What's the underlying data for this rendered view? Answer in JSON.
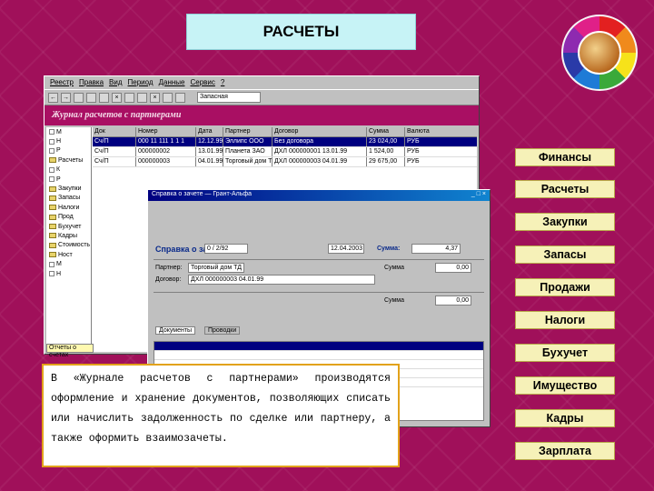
{
  "slide": {
    "title": "РАСЧЕТЫ"
  },
  "app_window": {
    "menu": [
      "Реестр",
      "Правка",
      "Вид",
      "Период",
      "Данные",
      "Сервис",
      "?"
    ],
    "toolbar_combo": "Запасная",
    "journal_title": "Журнал расчетов с партнерами",
    "tree_items": [
      "М",
      "Н",
      "Р",
      "Расчеты",
      "К",
      "Р",
      "Закупки",
      "Запасы",
      "Налоги",
      "Прод",
      "Бухучет",
      "Кадры",
      "Стоимость",
      "Ност",
      "М",
      "Н"
    ],
    "tree_footer": "Отчеты о счетах",
    "columns": [
      "Док",
      "Номер",
      "Дата",
      "Партнер",
      "Договор",
      "Сумма",
      "Валюта"
    ],
    "rows": [
      [
        "Сч/П",
        "000 11 111 1 1 1",
        "12.12.99",
        "Эллипс ООО",
        "Без договора",
        "23 024,00",
        "РУБ"
      ],
      [
        "Сч/П",
        "000000002",
        "13.01.99",
        "Планета ЗАО",
        "ДХЛ 000000001 13.01.99",
        "1 524,00",
        "РУБ"
      ],
      [
        "Сч/П",
        "000000003",
        "04.01.99",
        "Торговый дом ТД",
        "ДХЛ 000000003 04.01.99",
        "29 675,00",
        "РУБ"
      ]
    ]
  },
  "dialog": {
    "title": "Справка о зачете — Грант-Альфа",
    "subtitle_label": "Справка о зачете:",
    "number": "0 / 2/92",
    "date": "12.04.2003",
    "amount_label": "Сумма:",
    "amount": "4,37",
    "partner_label": "Партнер:",
    "partner_value": "Торговый дом ТД",
    "contract_label": "Договор:",
    "contract_value": "ДХЛ 000000003 04.01.99",
    "sum_label": "Сумма",
    "sum1": "0,00",
    "sum2": "0,00",
    "tabs": [
      "Документы",
      "Проводки"
    ]
  },
  "description": "В «Журнале расчетов с партнерами» производятся оформление и хранение документов, позволяющих списать или начислить задолженность по сделке или партнеру, а также оформить взаимозачеты.",
  "nav": [
    "Финансы",
    "Расчеты",
    "Закупки",
    "Запасы",
    "Продажи",
    "Налоги",
    "Бухучет",
    "Имущество",
    "Кадры",
    "Зарплата"
  ]
}
